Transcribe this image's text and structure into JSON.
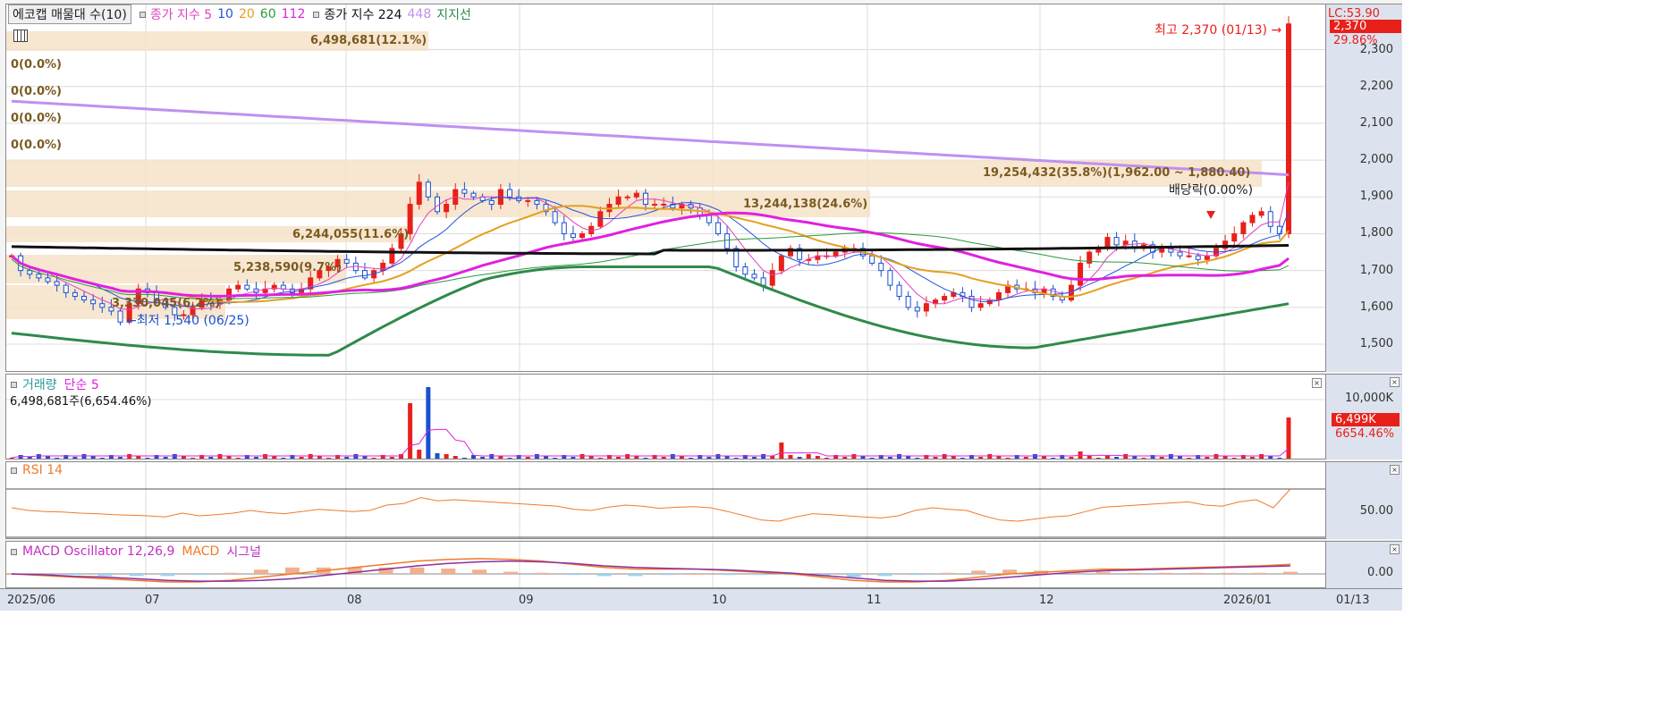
{
  "legend": {
    "stock_name": "에코캡 매물대 수(10)",
    "ma_label": "종가 지수 5",
    "ma10": "10",
    "ma20": "20",
    "ma60": "60",
    "ma112": "112",
    "ma224_label": "종가 지수 224",
    "ma448": "448",
    "support_label": "지지선"
  },
  "colors": {
    "up": "#e8201a",
    "down": "#1a4fd0",
    "ma5": "#e040c0",
    "ma10": "#2255dd",
    "ma20": "#e6a020",
    "ma60": "#2a9a3a",
    "ma112": "#e020e0",
    "ma224": "#111111",
    "ma448": "#c090f0",
    "support": "#2f8a4a",
    "rsi": "#f07a2a",
    "macd": "#f07a2a",
    "signal": "#8b2fa0",
    "osc_pos": "#f0b090",
    "osc_neg": "#9ad4f0",
    "vp": "#f6e2c8"
  },
  "price_panel": {
    "price_axis_ticks": [
      "2,300",
      "2,200",
      "2,100",
      "2,000",
      "1,900",
      "1,800",
      "1,700",
      "1,600",
      "1,500"
    ],
    "lc_label": "LC:53.90",
    "current_price": "2,370",
    "current_change": "29.86%",
    "high_label": "최고 2,370 (01/13) →",
    "low_label": "←최저 1,540 (06/25)",
    "dividend_label": "배당락(0.00%)",
    "zero_labels": [
      "0(0.0%)",
      "0(0.0%)",
      "0(0.0%)",
      "0(0.0%)"
    ],
    "volume_profile": [
      {
        "label": "6,498,681(12.1%)"
      },
      {
        "label": "19,254,432(35.8%)(1,962.00 ~ 1,880.40)"
      },
      {
        "label": "13,244,138(24.6%)"
      },
      {
        "label": "6,244,055(11.6%)"
      },
      {
        "label": "5,238,590(9.7%)"
      },
      {
        "label": "3,330,045(6.2%)"
      }
    ]
  },
  "volume_panel": {
    "title": "거래량",
    "ma_label": "단순 5",
    "value_label": "6,498,681주(6,654.46%)",
    "axis_tick": "10,000K",
    "current_value": "6,499K",
    "current_pct": "6654.46%"
  },
  "rsi_panel": {
    "title": "RSI 14",
    "axis_tick": "50.00"
  },
  "macd_panel": {
    "title": "MACD Oscillator 12,26,9",
    "macd_label": "MACD",
    "signal_label": "시그널",
    "axis_tick": "0.00"
  },
  "x_axis": {
    "labels": [
      "2025/06",
      "07",
      "08",
      "09",
      "10",
      "11",
      "12",
      "2026/01"
    ],
    "last_date": "01/13"
  },
  "chart_data": {
    "type": "candlestick",
    "title": "에코캡",
    "x_range": [
      "2025/06",
      "2026/01/13"
    ],
    "ylim": [
      1450,
      2380
    ],
    "grid": true,
    "high": {
      "value": 2370,
      "date": "01/13"
    },
    "low": {
      "value": 1540,
      "date": "06/25"
    },
    "volume_profile": [
      {
        "volume": 6498681,
        "pct": 12.1
      },
      {
        "volume": 19254432,
        "pct": 35.8,
        "range": [
          1880.4,
          1962.0
        ]
      },
      {
        "volume": 13244138,
        "pct": 24.6
      },
      {
        "volume": 6244055,
        "pct": 11.6
      },
      {
        "volume": 5238590,
        "pct": 9.7
      },
      {
        "volume": 3330045,
        "pct": 6.2
      }
    ],
    "candle_closes_approx": [
      1740,
      1700,
      1690,
      1680,
      1670,
      1660,
      1640,
      1630,
      1620,
      1610,
      1600,
      1590,
      1560,
      1610,
      1650,
      1640,
      1620,
      1600,
      1580,
      1580,
      1600,
      1620,
      1610,
      1620,
      1650,
      1660,
      1650,
      1640,
      1650,
      1660,
      1650,
      1640,
      1650,
      1680,
      1700,
      1710,
      1730,
      1720,
      1700,
      1680,
      1700,
      1720,
      1760,
      1800,
      1880,
      1940,
      1900,
      1860,
      1880,
      1920,
      1910,
      1900,
      1890,
      1880,
      1920,
      1900,
      1890,
      1890,
      1880,
      1860,
      1830,
      1800,
      1790,
      1800,
      1820,
      1860,
      1880,
      1900,
      1900,
      1910,
      1880,
      1880,
      1880,
      1870,
      1880,
      1870,
      1850,
      1830,
      1800,
      1760,
      1710,
      1690,
      1680,
      1660,
      1700,
      1740,
      1760,
      1730,
      1730,
      1740,
      1740,
      1750,
      1760,
      1760,
      1740,
      1720,
      1700,
      1660,
      1630,
      1600,
      1590,
      1610,
      1620,
      1630,
      1640,
      1630,
      1600,
      1610,
      1620,
      1640,
      1660,
      1650,
      1650,
      1640,
      1650,
      1630,
      1620,
      1660,
      1720,
      1750,
      1760,
      1790,
      1770,
      1780,
      1760,
      1770,
      1750,
      1760,
      1750,
      1740,
      1740,
      1730,
      1740,
      1760,
      1780,
      1800,
      1830,
      1850,
      1860,
      1820,
      1800,
      2370
    ],
    "rsi_approx": [
      55,
      50,
      48,
      47,
      45,
      44,
      42,
      41,
      40,
      38,
      45,
      40,
      42,
      45,
      50,
      46,
      44,
      48,
      52,
      50,
      48,
      50,
      60,
      63,
      74,
      68,
      70,
      68,
      66,
      64,
      62,
      60,
      58,
      52,
      50,
      56,
      60,
      58,
      54,
      56,
      57,
      55,
      48,
      40,
      32,
      30,
      38,
      44,
      42,
      40,
      38,
      36,
      40,
      50,
      55,
      52,
      50,
      40,
      32,
      30,
      34,
      38,
      40,
      48,
      56,
      58,
      60,
      62,
      64,
      66,
      60,
      58,
      66,
      70,
      55,
      90
    ],
    "macd_approx": [
      0,
      -2,
      -4,
      -6,
      -8,
      -10,
      -10,
      -8,
      -4,
      0,
      4,
      8,
      12,
      16,
      18,
      19,
      18,
      16,
      12,
      8,
      6,
      6,
      6,
      4,
      2,
      0,
      -4,
      -8,
      -10,
      -10,
      -8,
      -4,
      0,
      2,
      4,
      6,
      6,
      7,
      8,
      9,
      10,
      12
    ],
    "signal_approx": [
      0,
      -1,
      -3,
      -4,
      -6,
      -8,
      -9,
      -9,
      -8,
      -6,
      -2,
      2,
      6,
      10,
      13,
      15,
      16,
      15,
      13,
      10,
      8,
      7,
      6,
      5,
      3,
      1,
      -2,
      -5,
      -8,
      -9,
      -9,
      -7,
      -4,
      -1,
      2,
      4,
      5,
      6,
      7,
      8,
      9,
      10
    ]
  }
}
